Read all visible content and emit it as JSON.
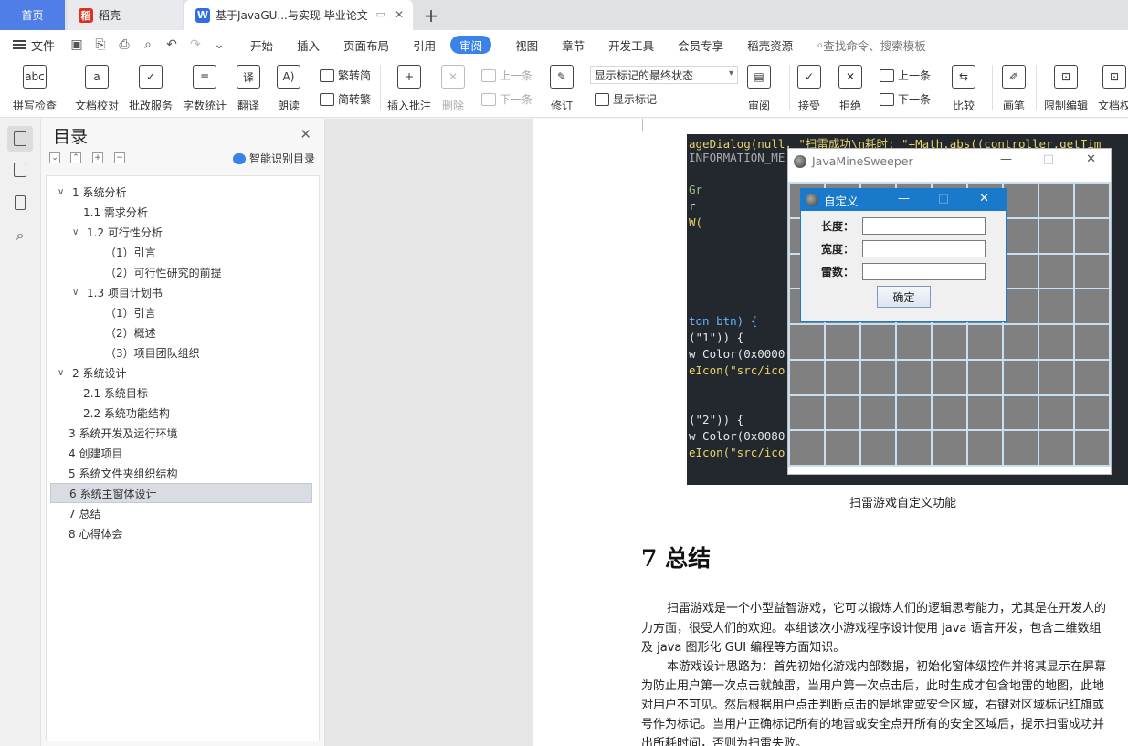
{
  "tabs": {
    "home": "首页",
    "wps": "稻壳",
    "doc": "基于JavaGU...与实现 毕业论文",
    "new": "+"
  },
  "menu": {
    "file": "文件",
    "items": [
      "开始",
      "插入",
      "页面布局",
      "引用",
      "审阅",
      "视图",
      "章节",
      "开发工具",
      "会员专享",
      "稻壳资源"
    ],
    "active": "审阅",
    "search": "查找命令、搜索模板"
  },
  "ribbon": {
    "spell_check": "拼写检查",
    "doc_proof": "文档校对",
    "grading": "批改服务",
    "word_count": "字数统计",
    "translate": "翻译",
    "read_aloud": "朗读",
    "trad_simp": "繁转简",
    "simp_trad": "简转繁",
    "insert_comment": "插入批注",
    "delete": "删除",
    "prev": "上一条",
    "next": "下一条",
    "revise": "修订",
    "markup_select": "显示标记的最终状态",
    "show_markup": "显示标记",
    "review": "审阅",
    "accept": "接受",
    "reject": "拒绝",
    "prev2": "上一条",
    "next2": "下一条",
    "compare": "比较",
    "pen": "画笔",
    "restrict_edit": "限制编辑",
    "doc_perm": "文档权"
  },
  "toc": {
    "title": "目录",
    "smart": "智能识别目录",
    "items": [
      {
        "label": "1 系统分析",
        "level": 1,
        "caret": "∨"
      },
      {
        "label": "1.1 需求分析",
        "level": 2,
        "caret": ""
      },
      {
        "label": "1.2 可行性分析",
        "level": 2,
        "caret": "∨"
      },
      {
        "label": "（1）引言",
        "level": 3,
        "caret": ""
      },
      {
        "label": "（2）可行性研究的前提",
        "level": 3,
        "caret": ""
      },
      {
        "label": "1.3 项目计划书",
        "level": 2,
        "caret": "∨"
      },
      {
        "label": "（1）引言",
        "level": 3,
        "caret": ""
      },
      {
        "label": "（2）概述",
        "level": 3,
        "caret": ""
      },
      {
        "label": "（3）项目团队组织",
        "level": 3,
        "caret": ""
      },
      {
        "label": "2 系统设计",
        "level": 1,
        "caret": "∨"
      },
      {
        "label": "2.1 系统目标",
        "level": 2,
        "caret": ""
      },
      {
        "label": "2.2 系统功能结构",
        "level": 2,
        "caret": ""
      },
      {
        "label": "3 系统开发及运行环境",
        "level": 0,
        "caret": ""
      },
      {
        "label": "4 创建项目",
        "level": 0,
        "caret": ""
      },
      {
        "label": "5 系统文件夹组织结构",
        "level": 0,
        "caret": ""
      },
      {
        "label": "6 系统主窗体设计",
        "level": 0,
        "caret": "",
        "selected": true
      },
      {
        "label": "7 总结",
        "level": 0,
        "caret": ""
      },
      {
        "label": "8 心得体会",
        "level": 0,
        "caret": ""
      }
    ]
  },
  "figure": {
    "code_lines": [
      "ageDialog(null, \"扫雷成功\\n耗时: \"+Math.abs((controller.getTim",
      "INFORMATION_ME",
      "Gr",
      "r",
      "W(",
      "ton btn) {",
      "(\"1\")) {",
      "w Color(0x0000",
      "eIcon(\"src/ico",
      "(\"2\")) {",
      "w Color(0x0080",
      "eIcon(\"src/ico"
    ],
    "mine_window_title": "JavaMineSweeper",
    "dialog": {
      "title": "自定义",
      "length_label": "长度：",
      "width_label": "宽度：",
      "mines_label": "雷数：",
      "length_value": "",
      "width_value": "",
      "mines_value": "",
      "ok": "确定"
    }
  },
  "document": {
    "caption": "扫雷游戏自定义功能",
    "heading": "7 总结",
    "paragraphs": [
      "扫雷游戏是一个小型益智游戏，它可以锻炼人们的逻辑思考能力，尤其是在开发人的",
      "力方面，很受人们的欢迎。本组该次小游戏程序设计使用 java 语言开发，包含二维数组",
      "及 java 图形化 GUI 编程等方面知识。",
      "本游戏设计思路为：首先初始化游戏内部数据，初始化窗体级控件并将其显示在屏幕",
      "为防止用户第一次点击就触雷，当用户第一次点击后，此时生成才包含地雷的地图，此地",
      "对用户不可见。然后根据用户点击判断点击的是地雷或安全区域，右键对区域标记红旗或",
      "号作为标记。当用户正确标记所有的地雷或安全点开所有的安全区域后，提示扫雷成功并",
      "出所耗时间，否则为扫雷失败。"
    ]
  }
}
